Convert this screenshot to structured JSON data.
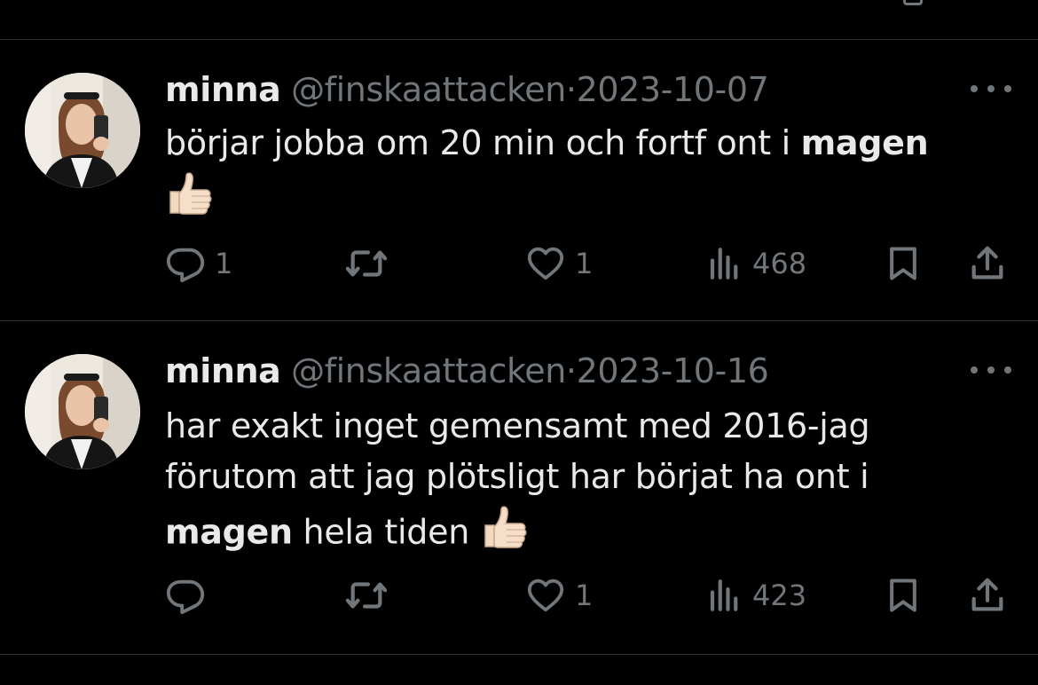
{
  "theme": {
    "background": "#000000",
    "text_primary": "#e7e9ea",
    "text_secondary": "#71767b",
    "divider": "#2f3336"
  },
  "tweets": [
    {
      "display_name": "minna",
      "handle": "@finskaattacken",
      "separator": "·",
      "date": "2023-10-07",
      "text_segments": [
        {
          "text": "börjar jobba om 20 min och fortf ont i ",
          "bold": false
        },
        {
          "text": "magen",
          "bold": true
        }
      ],
      "emoji": "thumbs-up",
      "replies": "1",
      "retweets": "",
      "likes": "1",
      "views": "468"
    },
    {
      "display_name": "minna",
      "handle": "@finskaattacken",
      "separator": "·",
      "date": "2023-10-16",
      "text_segments": [
        {
          "text": "har exakt inget gemensamt med 2016-jag förutom att jag plötsligt har börjat ha ont i ",
          "bold": false
        },
        {
          "text": "magen",
          "bold": true
        },
        {
          "text": " hela tiden",
          "bold": false
        }
      ],
      "emoji": "thumbs-up",
      "replies": "",
      "retweets": "",
      "likes": "1",
      "views": "423"
    }
  ],
  "icons": {
    "reply": "reply-icon",
    "retweet": "retweet-icon",
    "like": "heart-icon",
    "views": "views-icon",
    "bookmark": "bookmark-icon",
    "share": "share-icon",
    "more": "more-icon"
  }
}
